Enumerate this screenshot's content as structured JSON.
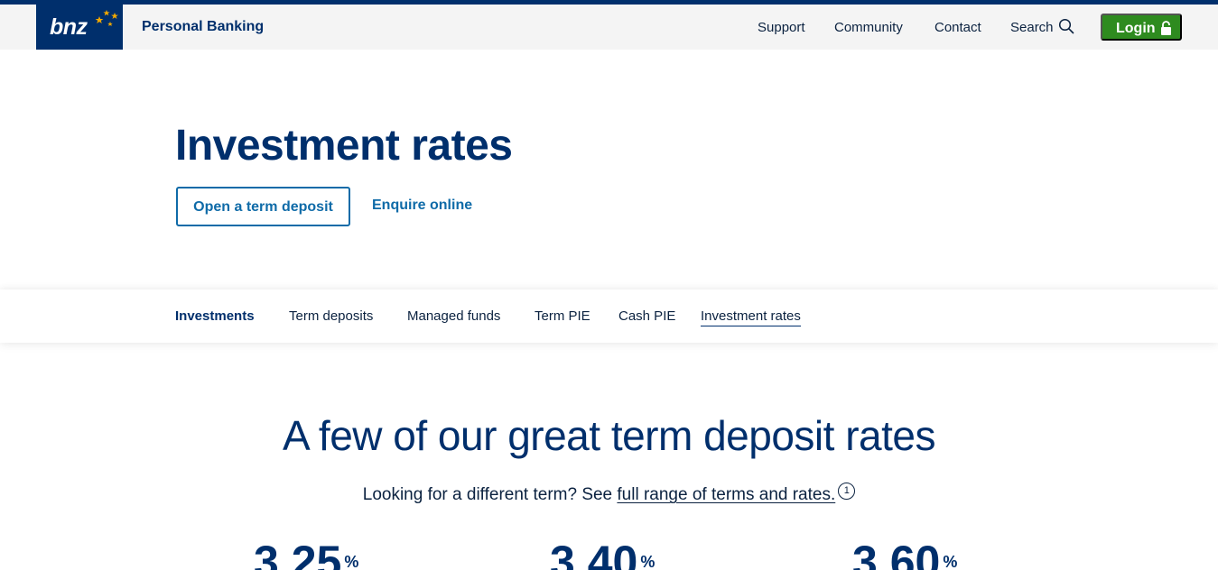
{
  "header": {
    "logo_text": "bnz",
    "brand_label": "Personal Banking",
    "nav": {
      "support": "Support",
      "community": "Community",
      "contact": "Contact",
      "search": "Search"
    },
    "login_label": "Login",
    "colors": {
      "navy": "#002f6c",
      "login_green": "#2e8b1f",
      "star_gold": "#f2a900"
    }
  },
  "hero": {
    "title": "Investment rates",
    "primary_button": "Open a term deposit",
    "secondary_link": "Enquire online"
  },
  "subnav": {
    "items": [
      "Investments",
      "Term deposits",
      "Managed funds",
      "Term PIE",
      "Cash PIE",
      "Investment rates"
    ],
    "active": "Investment rates"
  },
  "rates_section": {
    "heading": "A few of our great term deposit rates",
    "sub_prefix": "Looking for a different term? See ",
    "sub_link": "full range of terms and rates.",
    "footnote": "1",
    "rates": [
      {
        "value": "3.25",
        "unit": "%"
      },
      {
        "value": "3.40",
        "unit": "%"
      },
      {
        "value": "3.60",
        "unit": "%"
      }
    ]
  }
}
